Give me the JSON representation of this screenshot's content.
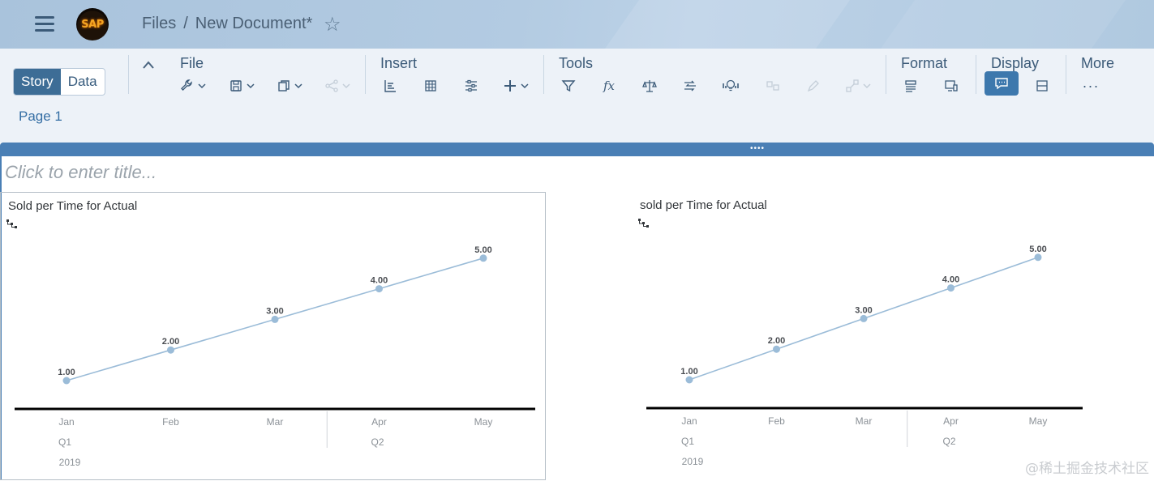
{
  "shell": {
    "logo_text": "SAP",
    "breadcrumb": {
      "root": "Files",
      "separator": "/",
      "document": "New Document*"
    }
  },
  "toolbar": {
    "mode_tabs": [
      {
        "label": "Story",
        "selected": true
      },
      {
        "label": "Data",
        "selected": false
      }
    ],
    "groups": {
      "file": "File",
      "insert": "Insert",
      "tools": "Tools",
      "format": "Format",
      "display": "Display",
      "more": "More"
    },
    "icons": {
      "file": [
        "wrench-icon",
        "save-icon",
        "copy-icon",
        "share-icon"
      ],
      "insert": [
        "chart-icon",
        "table-icon",
        "input-control-icon",
        "add-icon"
      ],
      "tools": [
        "filter-icon",
        "formula-icon",
        "conditional-format-icon",
        "linked-analysis-icon",
        "smart-insights-icon",
        "data-change-icon",
        "edit-icon",
        "sharing-icon"
      ],
      "format": [
        "styling-icon",
        "device-preview-icon"
      ],
      "display": [
        "comment-icon",
        "layout-icon"
      ],
      "more": [
        "overflow-icon"
      ]
    },
    "accent": "#3d78ad"
  },
  "pages": [
    {
      "label": "Page 1",
      "active": true
    }
  ],
  "story": {
    "title_placeholder": "Click to enter title..."
  },
  "widgets": [
    {
      "title": "Sold per Time for Actual",
      "selected": true
    },
    {
      "title": "sold per Time for Actual",
      "selected": false
    }
  ],
  "chart_data": [
    {
      "type": "line",
      "title": "Sold per Time for Actual",
      "categories": [
        "Jan",
        "Feb",
        "Mar",
        "Apr",
        "May"
      ],
      "quarters": [
        {
          "label": "Q1",
          "months": 3
        },
        {
          "label": "Q2",
          "months": 2
        }
      ],
      "year": "2019",
      "series": [
        {
          "values": [
            1.0,
            2.0,
            3.0,
            4.0,
            5.0
          ],
          "labels": [
            "1.00",
            "2.00",
            "3.00",
            "4.00",
            "5.00"
          ],
          "color": "#9bbcd8"
        }
      ],
      "ylim": [
        0,
        5.5
      ],
      "grid": false
    },
    {
      "type": "line",
      "title": "sold per Time for Actual",
      "categories": [
        "Jan",
        "Feb",
        "Mar",
        "Apr",
        "May"
      ],
      "quarters": [
        {
          "label": "Q1",
          "months": 3
        },
        {
          "label": "Q2",
          "months": 2
        }
      ],
      "year": "2019",
      "series": [
        {
          "values": [
            1.0,
            2.0,
            3.0,
            4.0,
            5.0
          ],
          "labels": [
            "1.00",
            "2.00",
            "3.00",
            "4.00",
            "5.00"
          ],
          "color": "#9bbcd8"
        }
      ],
      "ylim": [
        0,
        5.5
      ],
      "grid": false
    }
  ],
  "watermark": "@稀土掘金技术社区"
}
